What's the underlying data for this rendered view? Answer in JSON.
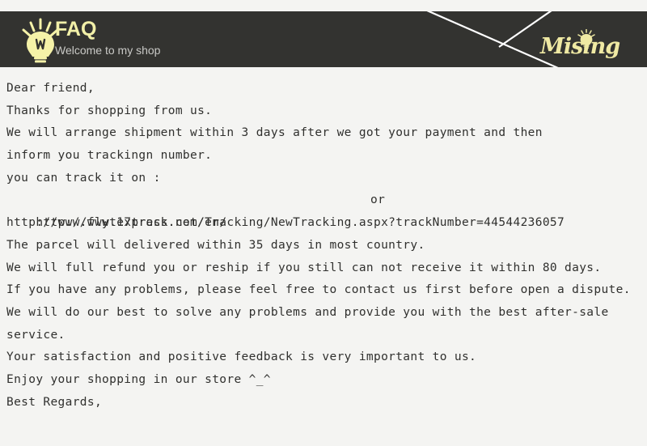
{
  "page": {
    "background_color": "#f4f4f2",
    "text_color": "#30302e"
  },
  "header": {
    "background_color": "#333330",
    "title": "FAQ",
    "title_color": "#f2f0a8",
    "subtitle": "Welcome to my shop",
    "subtitle_color": "#c9c9c6",
    "bulb_icon_name": "lightbulb-icon",
    "bulb_color": "#f5f2a8",
    "decor_line_color": "#ffffff",
    "brand": {
      "text_before": "Mis",
      "text_after": "ng",
      "full_text": "Mising",
      "color": "#efe9a3",
      "bulb_icon_name": "lightbulb-icon-small"
    }
  },
  "letter": {
    "lines": [
      "Dear friend,",
      "Thanks for shopping from us.",
      "We will arrange shipment within 3 days after we got your payment and then",
      "inform you trackingn number.",
      "you can track it on :",
      "http://www.17track.net/en/",
      "http://www.flytexpress.com/Tracking/NewTracking.aspx?trackNumber=44544236057",
      "The parcel will delivered within 35 days in most country.",
      "We will full refund you or reship if you still can not receive it within 80 days.",
      "If you have any problems, please feel free to contact us first before open a dispute.",
      "We will do our best to solve any problems and provide you with the best after-sale",
      "service.",
      "Your satisfaction and positive feedback is very important to us.",
      "Enjoy your shopping in our store ^_^",
      "Best Regards,"
    ],
    "or_label": "or",
    "tracking_number": "44544236057",
    "tracking_urls": [
      "http://www.17track.net/en/",
      "http://www.flytexpress.com/Tracking/NewTracking.aspx?trackNumber=44544236057"
    ]
  }
}
